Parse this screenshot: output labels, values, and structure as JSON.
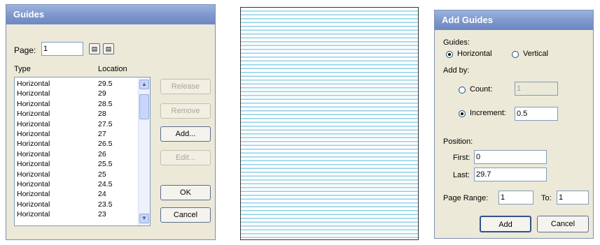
{
  "guides_dialog": {
    "title": "Guides",
    "page_label": "Page:",
    "page_value": "1",
    "col_type": "Type",
    "col_location": "Location",
    "rows": [
      {
        "type": "Horizontal",
        "location": "29.5"
      },
      {
        "type": "Horizontal",
        "location": "29"
      },
      {
        "type": "Horizontal",
        "location": "28.5"
      },
      {
        "type": "Horizontal",
        "location": "28"
      },
      {
        "type": "Horizontal",
        "location": "27.5"
      },
      {
        "type": "Horizontal",
        "location": "27"
      },
      {
        "type": "Horizontal",
        "location": "26.5"
      },
      {
        "type": "Horizontal",
        "location": "26"
      },
      {
        "type": "Horizontal",
        "location": "25.5"
      },
      {
        "type": "Horizontal",
        "location": "25"
      },
      {
        "type": "Horizontal",
        "location": "24.5"
      },
      {
        "type": "Horizontal",
        "location": "24"
      },
      {
        "type": "Horizontal",
        "location": "23.5"
      },
      {
        "type": "Horizontal",
        "location": "23"
      }
    ],
    "buttons": {
      "release": "Release",
      "remove": "Remove",
      "add": "Add...",
      "edit": "Edit...",
      "ok": "OK",
      "cancel": "Cancel"
    }
  },
  "add_guides_dialog": {
    "title": "Add Guides",
    "guides_label": "Guides:",
    "horizontal_label": "Horizontal",
    "vertical_label": "Vertical",
    "add_by_label": "Add by:",
    "count_label": "Count:",
    "count_value": "1",
    "increment_label": "Increment:",
    "increment_value": "0.5",
    "position_label": "Position:",
    "first_label": "First:",
    "first_value": "0",
    "last_label": "Last:",
    "last_value": "29.7",
    "page_range_label": "Page Range:",
    "page_range_from": "1",
    "to_label": "To:",
    "page_range_to": "1",
    "add_button": "Add",
    "cancel_button": "Cancel"
  },
  "colors": {
    "title_bar": "#7d97cc",
    "dialog_bg": "#ece9d8",
    "guide_line": "#8fd0e8"
  }
}
